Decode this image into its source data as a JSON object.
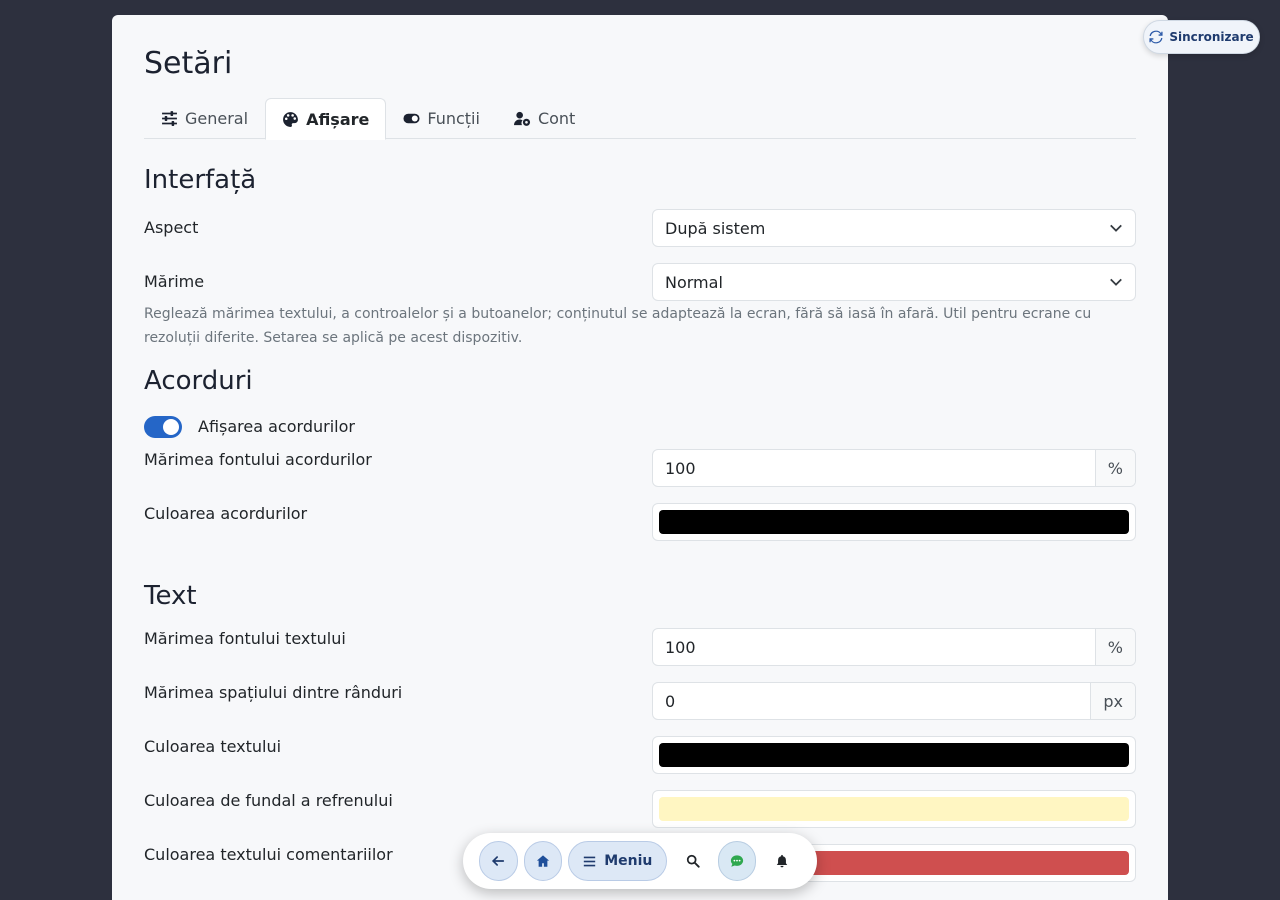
{
  "page": {
    "title": "Setări"
  },
  "tabs": [
    {
      "label": "General",
      "icon": "sliders-icon"
    },
    {
      "label": "Afișare",
      "icon": "palette-icon",
      "active": true
    },
    {
      "label": "Funcții",
      "icon": "toggle-icon"
    },
    {
      "label": "Cont",
      "icon": "user-gear-icon"
    }
  ],
  "interface": {
    "title": "Interfață",
    "aspect_label": "Aspect",
    "aspect_value": "După sistem",
    "size_label": "Mărime",
    "size_value": "Normal",
    "size_help": "Reglează mărimea textului, a controalelor și a butoanelor; conținutul se adaptează la ecran, fără să iasă în afară. Util pentru ecrane cu rezoluții diferite. Setarea se aplică pe acest dispozitiv."
  },
  "chords": {
    "title": "Acorduri",
    "show_label": "Afișarea acordurilor",
    "show_enabled": true,
    "font_size_label": "Mărimea fontului acordurilor",
    "font_size_value": "100",
    "font_size_unit": "%",
    "color_label": "Culoarea acordurilor",
    "color_value": "#000000"
  },
  "text": {
    "title": "Text",
    "font_size_label": "Mărimea fontului textului",
    "font_size_value": "100",
    "font_size_unit": "%",
    "line_spacing_label": "Mărimea spațiului dintre rânduri",
    "line_spacing_value": "0",
    "line_spacing_unit": "px",
    "color_label": "Culoarea textului",
    "color_value": "#000000",
    "chorus_bg_label": "Culoarea de fundal a refrenului",
    "chorus_bg_value": "#fff6c2",
    "comments_color_label": "Culoarea textului comentariilor",
    "comments_color_value": "#cf4f4f"
  },
  "sync": {
    "label": "Sincronizare"
  },
  "dock": {
    "menu_label": "Meniu"
  },
  "colors": {
    "accent": "#2566c7",
    "background": "#2d303e",
    "card": "#f7f8fa"
  }
}
